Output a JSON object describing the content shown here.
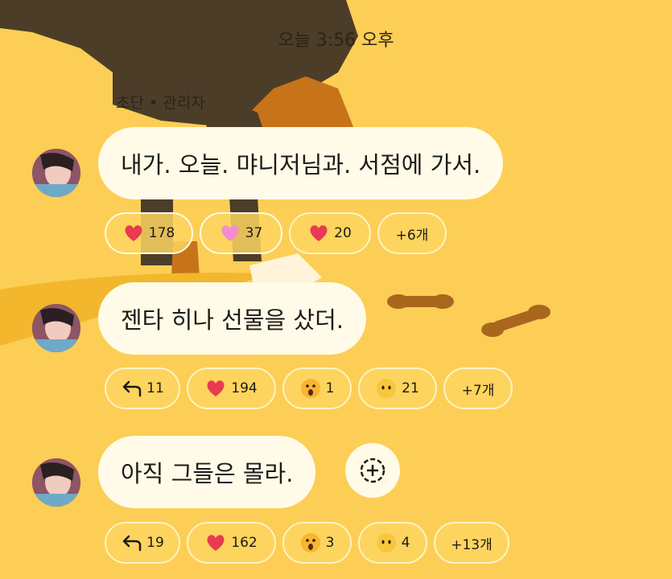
{
  "timestamp": "오늘 3:56 오후",
  "sender": "초단 • 관리자",
  "messages": [
    {
      "text": "내가. 오늘. 먀니저님과. 서점에 가서.",
      "reactions": [
        {
          "icon": "red-heart-icon",
          "count": "178"
        },
        {
          "icon": "pink-heart-icon",
          "count": "37"
        },
        {
          "icon": "red-heart-icon",
          "count": "20"
        },
        {
          "icon": "",
          "count": "+6개"
        }
      ]
    },
    {
      "text": "젠타 히나 선물을 샀더.",
      "reactions": [
        {
          "icon": "reply-arrow-icon",
          "count": "11"
        },
        {
          "icon": "red-heart-icon",
          "count": "194"
        },
        {
          "icon": "surprised-face-icon",
          "count": "1"
        },
        {
          "icon": "blank-face-icon",
          "count": "21"
        },
        {
          "icon": "",
          "count": "+7개"
        }
      ]
    },
    {
      "text": "아직 그들은 몰라.",
      "reactions": [
        {
          "icon": "reply-arrow-icon",
          "count": "19"
        },
        {
          "icon": "red-heart-icon",
          "count": "162"
        },
        {
          "icon": "surprised-face-icon",
          "count": "3"
        },
        {
          "icon": "blank-face-icon",
          "count": "4"
        },
        {
          "icon": "",
          "count": "+13개"
        }
      ]
    }
  ],
  "add_reaction_icon": "add-reaction-icon",
  "colors": {
    "background": "#fcce55",
    "bubble": "#fffbe8",
    "heart": "#e83a52",
    "pink_heart": "#f58bd0"
  }
}
